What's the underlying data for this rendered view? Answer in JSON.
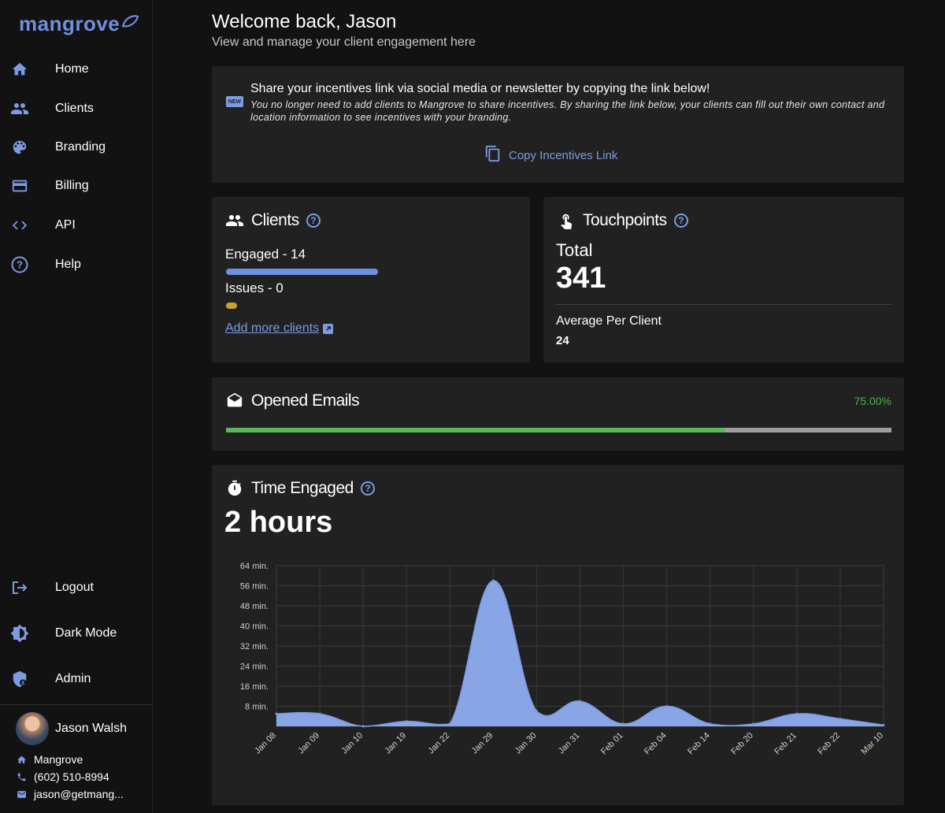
{
  "brand": {
    "name": "mangrove",
    "color": "#6f8fe0"
  },
  "nav": {
    "items": [
      {
        "label": "Home",
        "icon": "home-icon"
      },
      {
        "label": "Clients",
        "icon": "people-icon"
      },
      {
        "label": "Branding",
        "icon": "palette-icon"
      },
      {
        "label": "Billing",
        "icon": "credit-card-icon"
      },
      {
        "label": "API",
        "icon": "code-icon"
      },
      {
        "label": "Help",
        "icon": "help-circle-icon"
      }
    ],
    "bottom": [
      {
        "label": "Logout",
        "icon": "logout-icon"
      },
      {
        "label": "Dark Mode",
        "icon": "brightness-icon"
      },
      {
        "label": "Admin",
        "icon": "admin-shield-icon"
      }
    ]
  },
  "user": {
    "name": "Jason Walsh",
    "company": "Mangrove",
    "phone": "(602) 510-8994",
    "email": "jason@getmang..."
  },
  "header": {
    "welcome": "Welcome back, Jason",
    "subtitle": "View and manage your client engagement here"
  },
  "share": {
    "badge": "NEW",
    "title": "Share your incentives link via social media or newsletter by copying the link below!",
    "description": "You no longer need to add clients to Mangrove to share incentives. By sharing the link below, your clients can fill out their own contact and location information to see incentives with your branding.",
    "copy_label": "Copy Incentives Link"
  },
  "clients": {
    "title": "Clients",
    "engaged_label": "Engaged - 14",
    "engaged_value": 14,
    "issues_label": "Issues - 0",
    "issues_value": 0,
    "add_label": "Add more clients",
    "engaged_color": "#6f8fe0",
    "issues_color": "#c9a227"
  },
  "touchpoints": {
    "title": "Touchpoints",
    "total_label": "Total",
    "total_value": "341",
    "avg_label": "Average Per Client",
    "avg_value": "24"
  },
  "emails": {
    "title": "Opened Emails",
    "percent_label": "75.00%",
    "percent": 75
  },
  "time": {
    "title": "Time Engaged",
    "value": "2 hours"
  },
  "colors": {
    "accent": "#7b9be3",
    "success": "#5cb85c",
    "card_bg": "#212121",
    "page_bg": "#121212"
  },
  "chart_data": {
    "type": "area",
    "categories": [
      "Jan 08",
      "Jan 09",
      "Jan 10",
      "Jan 19",
      "Jan 22",
      "Jan 29",
      "Jan 30",
      "Jan 31",
      "Feb 01",
      "Feb 04",
      "Feb 14",
      "Feb 20",
      "Feb 21",
      "Feb 22",
      "Mar 10"
    ],
    "values": [
      5,
      5,
      0,
      2,
      1,
      58,
      6,
      10,
      1,
      8,
      1,
      1,
      5,
      3,
      0.5
    ],
    "y_ticks": [
      "8 min.",
      "16 min.",
      "24 min.",
      "32 min.",
      "40 min.",
      "48 min.",
      "56 min.",
      "64 min."
    ],
    "ylim": [
      0,
      64
    ],
    "grid": true,
    "fill_color": "#8aa5e6",
    "line_color": "#7b9be3"
  }
}
